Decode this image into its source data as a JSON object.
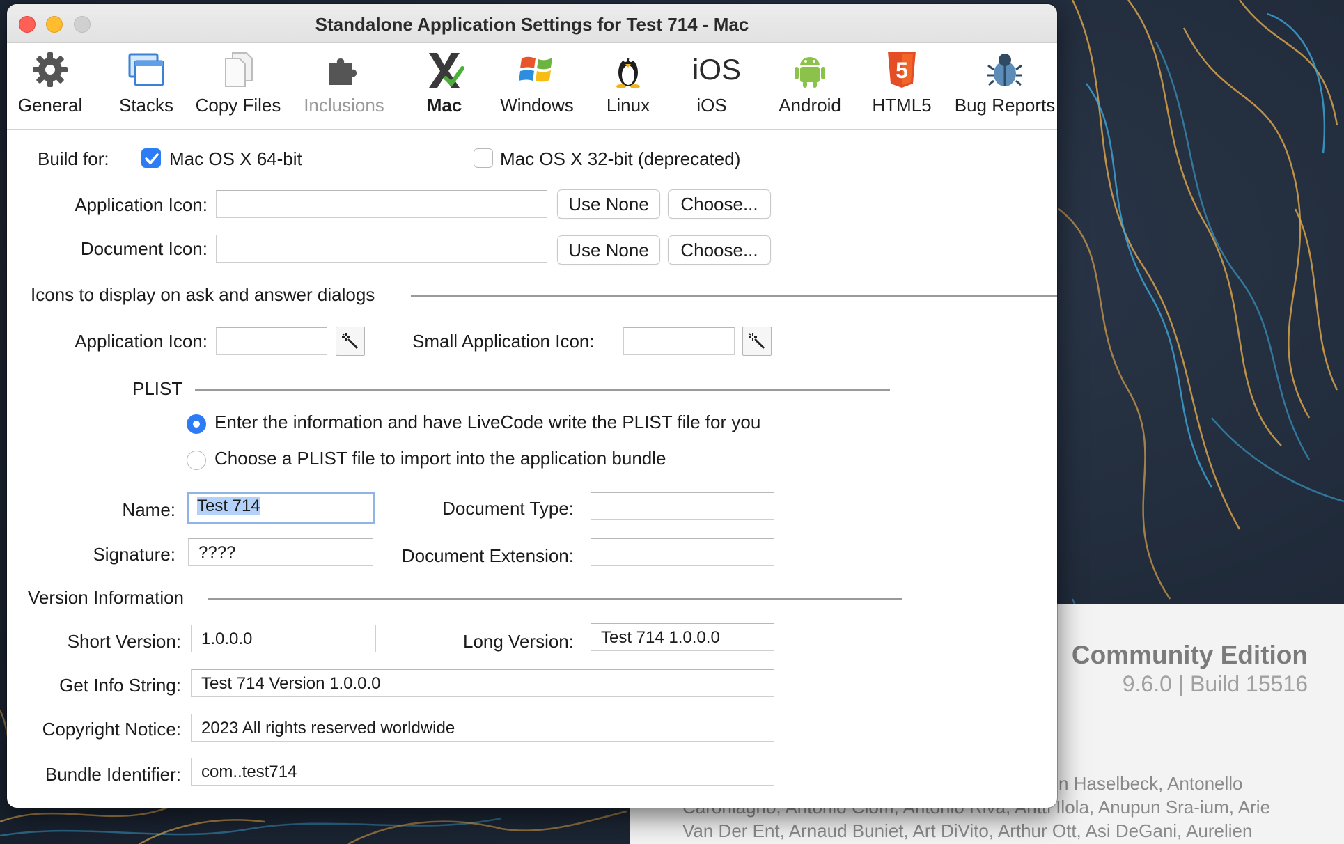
{
  "window": {
    "title": "Standalone Application Settings for Test 714 - Mac"
  },
  "toolbar": {
    "items": [
      {
        "label": "General",
        "icon": "gear-icon"
      },
      {
        "label": "Stacks",
        "icon": "stacks-icon"
      },
      {
        "label": "Copy Files",
        "icon": "copy-files-icon"
      },
      {
        "label": "Inclusions",
        "icon": "puzzle-icon",
        "state": "disabled"
      },
      {
        "label": "Mac",
        "icon": "mac-x-icon",
        "state": "active"
      },
      {
        "label": "Windows",
        "icon": "windows-icon"
      },
      {
        "label": "Linux",
        "icon": "linux-penguin-icon"
      },
      {
        "label": "iOS",
        "icon": "ios-icon",
        "glyph": "iOS"
      },
      {
        "label": "Android",
        "icon": "android-icon"
      },
      {
        "label": "HTML5",
        "icon": "html5-icon",
        "glyph": "5"
      },
      {
        "label": "Bug Reports",
        "icon": "bug-icon"
      }
    ]
  },
  "build": {
    "label": "Build for:",
    "option64": {
      "label": "Mac OS X 64-bit",
      "checked": true
    },
    "option32": {
      "label": "Mac OS X 32-bit (deprecated)",
      "checked": false
    }
  },
  "icons": {
    "application_label": "Application Icon:",
    "document_label": "Document Icon:",
    "application_value": "",
    "document_value": "",
    "use_none": "Use None",
    "choose": "Choose...",
    "choose_doc": "Choose..."
  },
  "dialog_icons": {
    "heading": "Icons to display on ask and answer dialogs",
    "application_label": "Application Icon:",
    "small_label": "Small Application Icon:",
    "application_value": "",
    "small_value": ""
  },
  "plist": {
    "heading": "PLIST",
    "option_write": {
      "label": "Enter the information and have LiveCode write the PLIST file for you",
      "selected": true
    },
    "option_import": {
      "label": "Choose a PLIST file to import into the application bundle",
      "selected": false
    },
    "name_label": "Name:",
    "name_value": "Test 714",
    "signature_label": "Signature:",
    "signature_value": "????",
    "doc_type_label": "Document Type:",
    "doc_type_value": "",
    "doc_ext_label": "Document Extension:",
    "doc_ext_value": ""
  },
  "version": {
    "heading": "Version Information",
    "short_label": "Short Version:",
    "short_value": "1.0.0.0",
    "long_label": "Long Version:",
    "long_value": "Test 714 1.0.0.0",
    "info_label": "Get Info String:",
    "info_value": "Test 714 Version 1.0.0.0",
    "copyright_label": "Copyright Notice:",
    "copyright_value": "2023  All rights reserved worldwide",
    "bundle_label": "Bundle Identifier:",
    "bundle_value": "com..test714"
  },
  "about": {
    "edition": "Community Edition",
    "build": "9.6.0 | Build 15516",
    "credits_line1": "n Haselbeck, Antonello",
    "credits_line2": "Caroniagno, Antonio Ciom, Antonio Riva, Antti Ilola, Anupun Sra-ium, Arie",
    "credits_line3": "Van Der Ent, Arnaud Buniet, Art DiVito, Arthur Ott, Asi DeGani, Aurelien"
  },
  "colors": {
    "accent": "#2d7cf6",
    "focus_ring": "#8fb4e8",
    "selection": "#b3d1f9"
  }
}
